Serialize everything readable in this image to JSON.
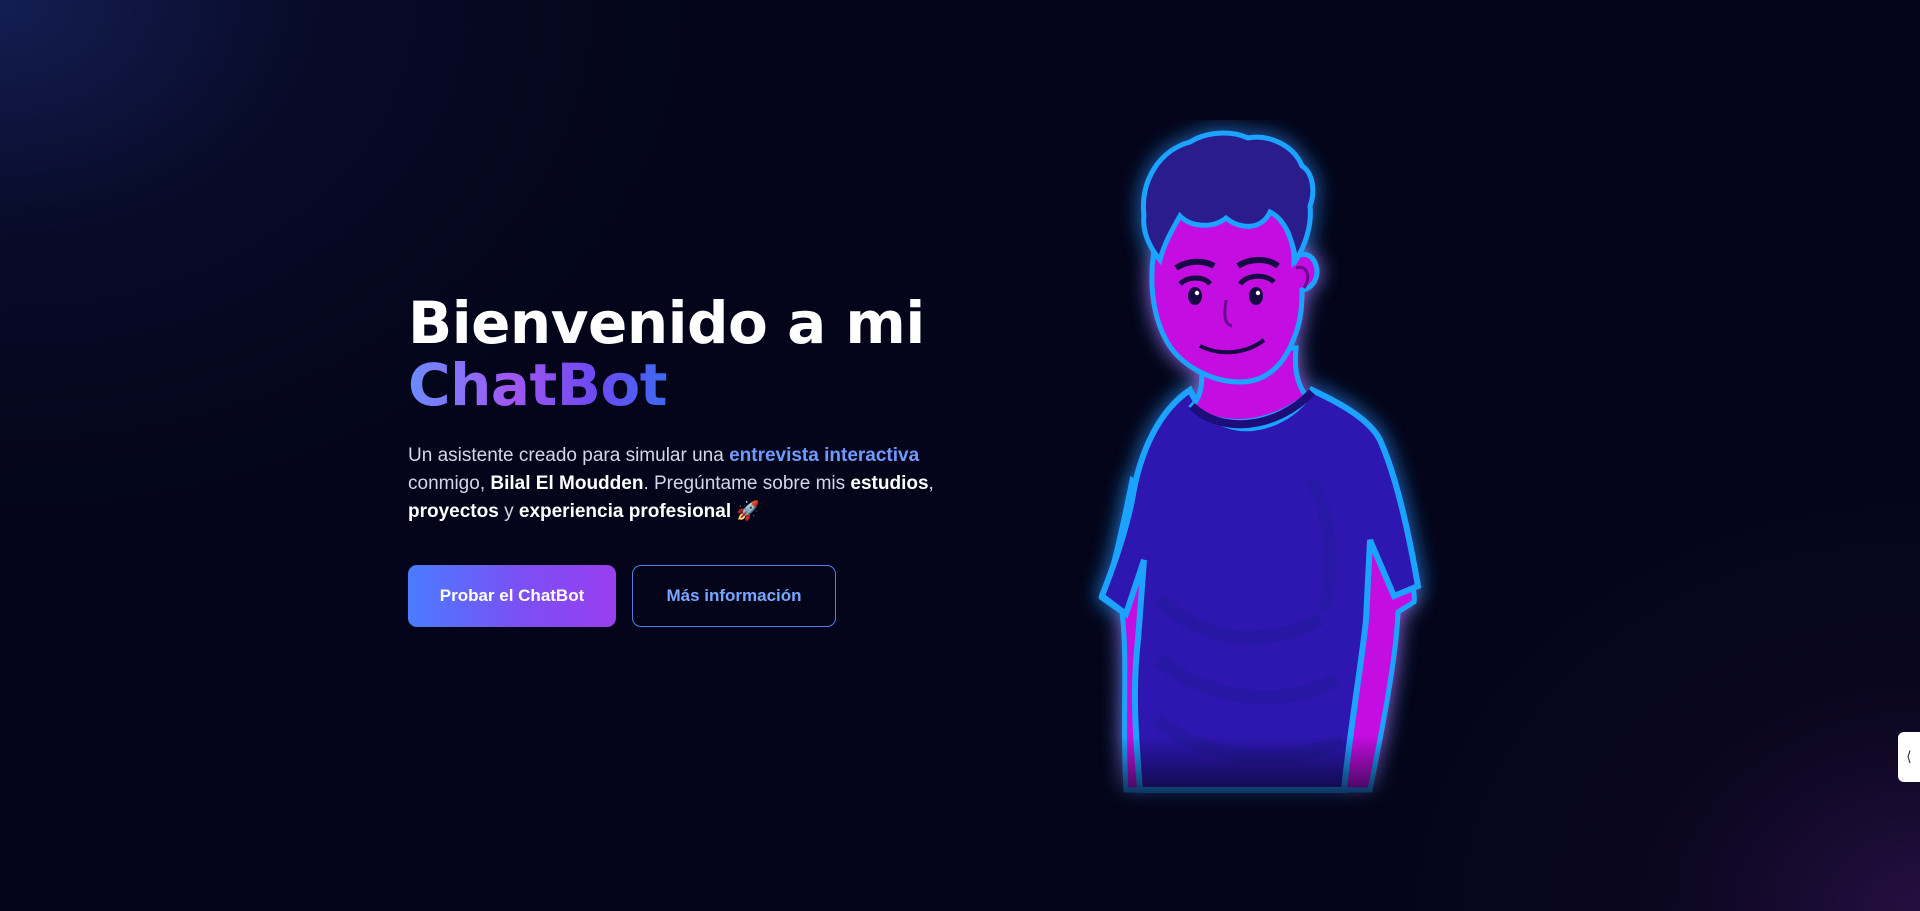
{
  "hero": {
    "title_line1": "Bienvenido a mi",
    "title_line2": "ChatBot",
    "description": {
      "part1": "Un asistente creado para simular una ",
      "highlight": "entrevista interactiva",
      "part2": " conmigo, ",
      "name": "Bilal El Moudden",
      "part3": ". Pregúntame sobre mis ",
      "bold1": "estudios",
      "sep1": ", ",
      "bold2": "proyectos",
      "sep2": " y ",
      "bold3": "experiencia profesional",
      "emoji": " 🚀"
    },
    "primary_button_label": "Probar el ChatBot",
    "secondary_button_label": "Más información"
  },
  "illustration": {
    "icon": "neon-avatar-illustration"
  },
  "side_tab": {
    "icon": "side-tab-icon",
    "glyph": "⟨"
  },
  "colors": {
    "background": "#04051a",
    "accent_blue": "#6f9bff",
    "accent_purple": "#9a3ef0",
    "neon_outline": "#1aa3ff",
    "neon_magenta": "#c40ee0",
    "shirt": "#2d15b0"
  }
}
